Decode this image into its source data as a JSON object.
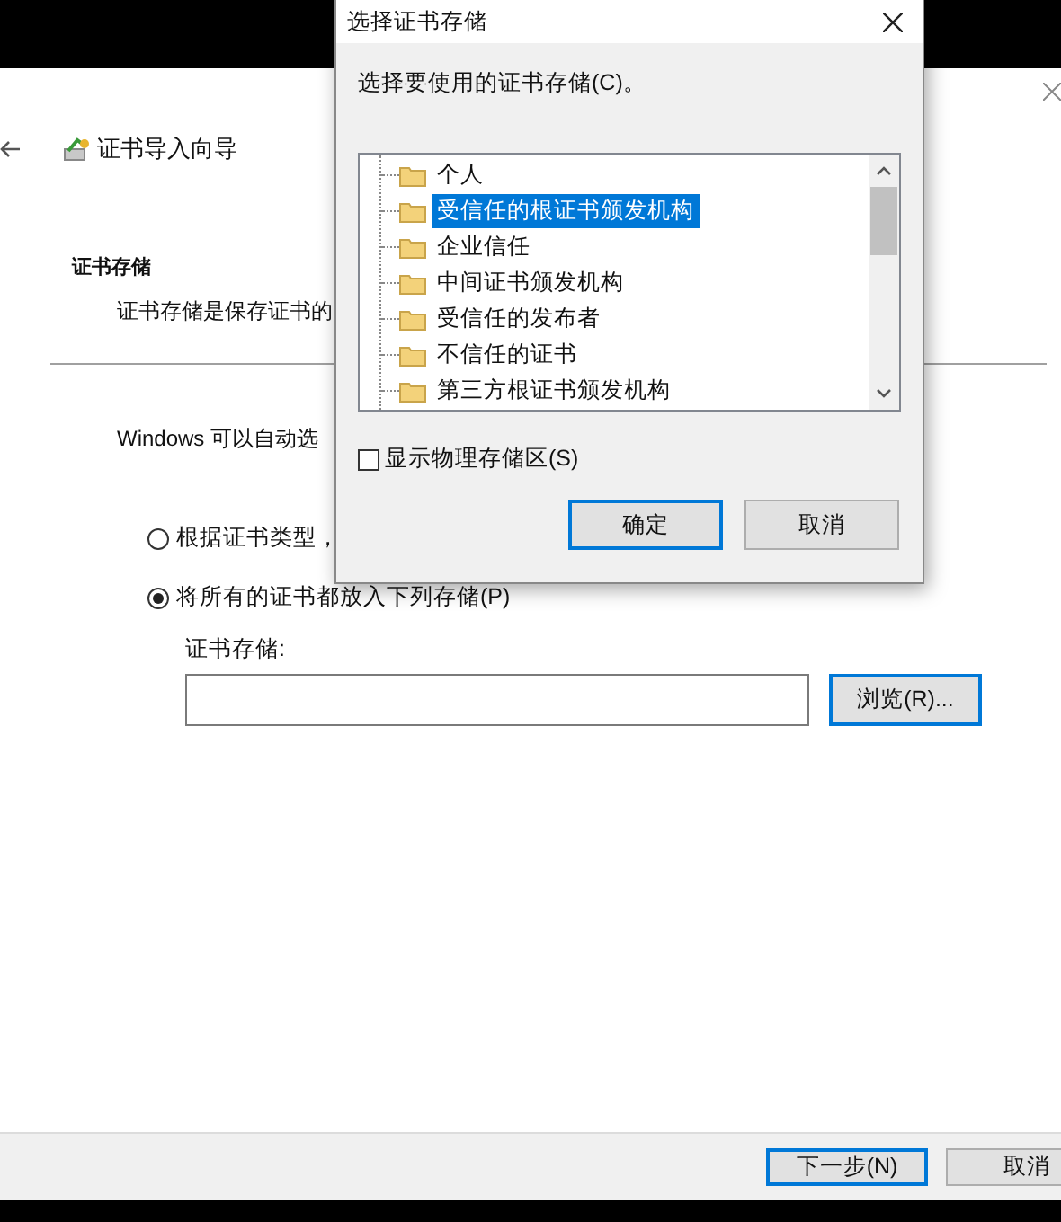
{
  "wizard": {
    "title": "证书导入向导",
    "section_heading": "证书存储",
    "section_description": "证书存储是保存证书的",
    "intro": "Windows 可以自动选",
    "options": [
      {
        "label": "根据证书类型，",
        "selected": false
      },
      {
        "label": "将所有的证书都放入下列存储(P)",
        "selected": true
      }
    ],
    "store_label": "证书存储:",
    "browse_button": "浏览(R)...",
    "buttons": [
      {
        "label": "下一步(N)",
        "default": true
      },
      {
        "label": "取消",
        "default": false
      }
    ]
  },
  "dialog": {
    "title": "选择证书存储",
    "prompt": "选择要使用的证书存储(C)。",
    "stores": [
      {
        "label": "个人",
        "selected": false
      },
      {
        "label": "受信任的根证书颁发机构",
        "selected": true
      },
      {
        "label": "企业信任",
        "selected": false
      },
      {
        "label": "中间证书颁发机构",
        "selected": false
      },
      {
        "label": "受信任的发布者",
        "selected": false
      },
      {
        "label": "不信任的证书",
        "selected": false
      },
      {
        "label": "第三方根证书颁发机构",
        "selected": false
      }
    ],
    "show_physical": {
      "label": "显示物理存储区(S)",
      "checked": false
    },
    "buttons": [
      {
        "label": "确定",
        "default": true
      },
      {
        "label": "取消",
        "default": false
      }
    ]
  }
}
